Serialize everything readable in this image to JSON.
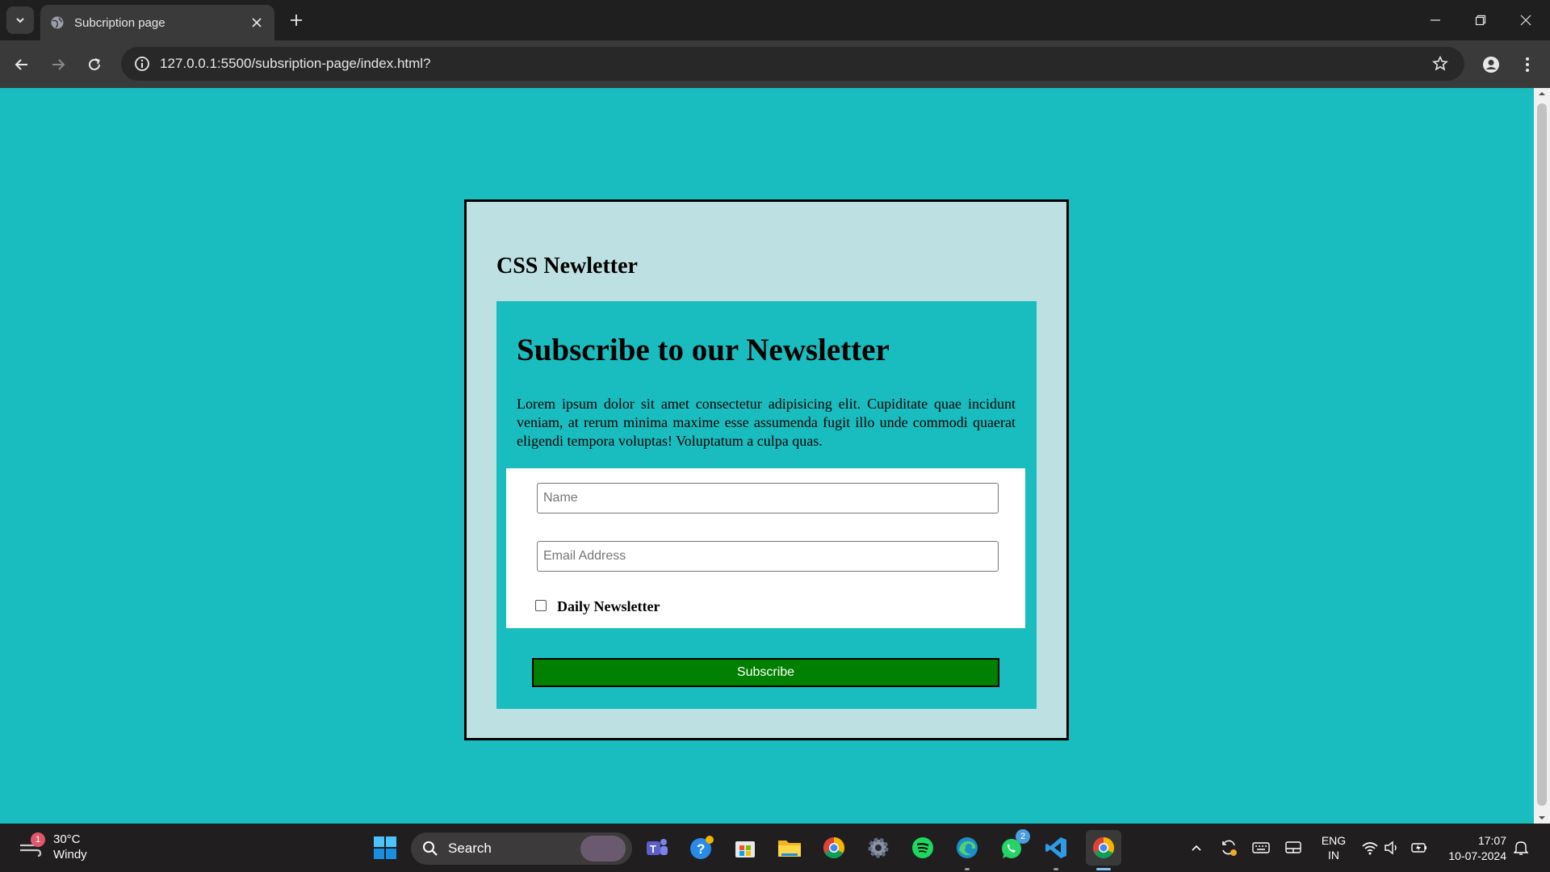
{
  "browser": {
    "tab_title": "Subcription page",
    "url": "127.0.0.1:5500/subsription-page/index.html?"
  },
  "page": {
    "site_title": "CSS Newletter",
    "heading": "Subscribe to our Newsletter",
    "description": "Lorem ipsum dolor sit amet consectetur adipisicing elit. Cupiditate quae incidunt veniam, at rerum minima maxime esse assumenda fugit illo unde commodi quaerat eligendi tempora voluptas! Voluptatum a culpa quas.",
    "name_placeholder": "Name",
    "name_value": "",
    "email_placeholder": "Email Address",
    "email_value": "",
    "checkbox_label": "Daily Newsletter",
    "checkbox_checked": false,
    "subscribe_label": "Subscribe"
  },
  "taskbar": {
    "weather_temp": "30°C",
    "weather_desc": "Windy",
    "weather_badge": "1",
    "search_label": "Search",
    "whatsapp_badge": "2",
    "lang_line1": "ENG",
    "lang_line2": "IN",
    "time": "17:07",
    "date": "10-07-2024"
  },
  "colors": {
    "page_bg": "#1abdbf",
    "card_outer_bg": "#bde1e2",
    "subscribe_bg": "#008000"
  }
}
